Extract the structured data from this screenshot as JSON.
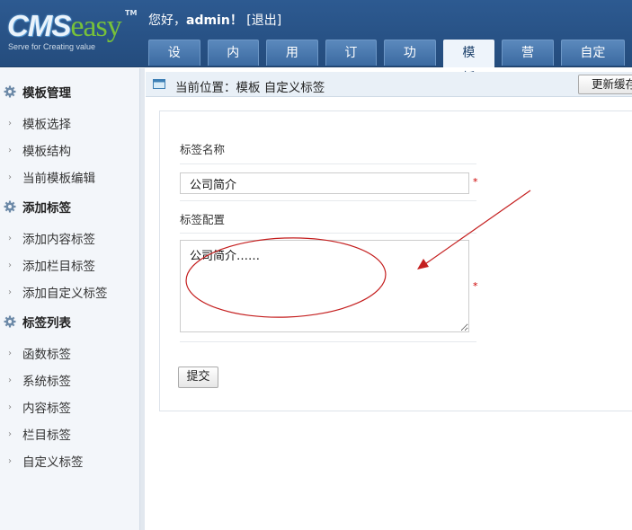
{
  "header": {
    "logo_cms": "CMS",
    "logo_easy": "easy",
    "logo_tm": "TM",
    "logo_slogan": "Serve for Creating value",
    "greeting_prefix": "您好，",
    "username": "admin",
    "greeting_suffix": "！",
    "logout_label": "[退出]",
    "tabs": [
      {
        "label": "设置"
      },
      {
        "label": "内容"
      },
      {
        "label": "用户"
      },
      {
        "label": "订单"
      },
      {
        "label": "功能"
      },
      {
        "label": "模板",
        "active": true
      },
      {
        "label": "营销"
      },
      {
        "label": "自定义"
      }
    ]
  },
  "sidebar": {
    "groups": [
      {
        "title": "模板管理",
        "items": [
          "模板选择",
          "模板结构",
          "当前模板编辑"
        ]
      },
      {
        "title": "添加标签",
        "items": [
          "添加内容标签",
          "添加栏目标签",
          "添加自定义标签"
        ]
      },
      {
        "title": "标签列表",
        "items": [
          "函数标签",
          "系统标签",
          "内容标签",
          "栏目标签",
          "自定义标签"
        ]
      }
    ]
  },
  "breadcrumb": {
    "text": "当前位置：模板 自定义标签",
    "cache_button": "更新缓存"
  },
  "form": {
    "name_label": "标签名称",
    "name_value": "公司简介",
    "config_label": "标签配置",
    "config_value": "公司简介……",
    "required_mark": "*",
    "submit_label": "提交"
  },
  "colors": {
    "header_bg": "#2a5285",
    "tab_bg": "#4a79b0",
    "annotation": "#c41e1e"
  },
  "icons": {
    "group_icon": "gear-icon",
    "item_marker": "caret-right-icon",
    "breadcrumb_icon": "window-icon"
  }
}
